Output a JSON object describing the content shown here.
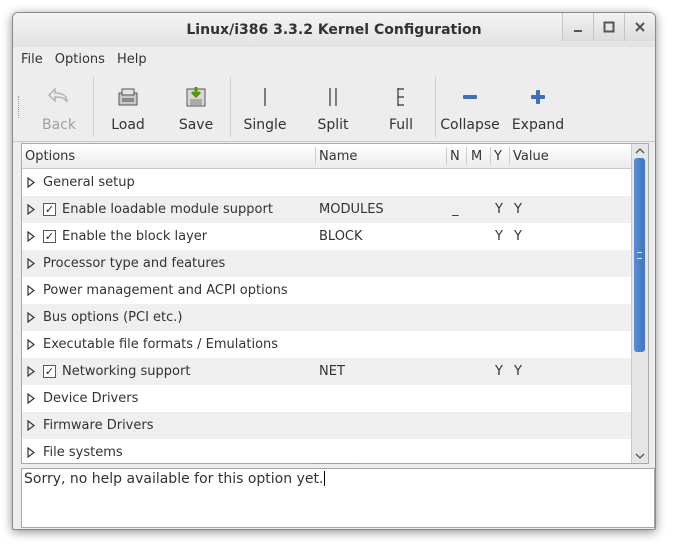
{
  "window": {
    "title": "Linux/i386 3.3.2 Kernel Configuration"
  },
  "menubar": {
    "items": [
      "File",
      "Options",
      "Help"
    ]
  },
  "toolbar": {
    "buttons": [
      {
        "label": "Back",
        "icon": "back-arrow-icon",
        "enabled": false
      },
      {
        "label": "Load",
        "icon": "load-icon",
        "enabled": true
      },
      {
        "label": "Save",
        "icon": "save-icon",
        "enabled": true
      },
      {
        "label": "Single",
        "icon": "single-view-icon",
        "enabled": true
      },
      {
        "label": "Split",
        "icon": "split-view-icon",
        "enabled": true
      },
      {
        "label": "Full",
        "icon": "full-view-icon",
        "enabled": true
      },
      {
        "label": "Collapse",
        "icon": "minus-icon",
        "enabled": true
      },
      {
        "label": "Expand",
        "icon": "plus-icon",
        "enabled": true
      }
    ]
  },
  "tree": {
    "columns": [
      "Options",
      "Name",
      "N",
      "M",
      "Y",
      "Value"
    ],
    "rows": [
      {
        "option": "General setup",
        "checked": null,
        "name": "",
        "n": "",
        "m": "",
        "y": "",
        "value": ""
      },
      {
        "option": "Enable loadable module support",
        "checked": true,
        "name": "MODULES",
        "n": "_",
        "m": "",
        "y": "Y",
        "value": "Y"
      },
      {
        "option": "Enable the block layer",
        "checked": true,
        "name": "BLOCK",
        "n": "",
        "m": "",
        "y": "Y",
        "value": "Y"
      },
      {
        "option": "Processor type and features",
        "checked": null,
        "name": "",
        "n": "",
        "m": "",
        "y": "",
        "value": ""
      },
      {
        "option": "Power management and ACPI options",
        "checked": null,
        "name": "",
        "n": "",
        "m": "",
        "y": "",
        "value": ""
      },
      {
        "option": "Bus options (PCI etc.)",
        "checked": null,
        "name": "",
        "n": "",
        "m": "",
        "y": "",
        "value": ""
      },
      {
        "option": "Executable file formats / Emulations",
        "checked": null,
        "name": "",
        "n": "",
        "m": "",
        "y": "",
        "value": ""
      },
      {
        "option": "Networking support",
        "checked": true,
        "name": "NET",
        "n": "",
        "m": "",
        "y": "Y",
        "value": "Y"
      },
      {
        "option": "Device Drivers",
        "checked": null,
        "name": "",
        "n": "",
        "m": "",
        "y": "",
        "value": ""
      },
      {
        "option": "Firmware Drivers",
        "checked": null,
        "name": "",
        "n": "",
        "m": "",
        "y": "",
        "value": ""
      },
      {
        "option": "File systems",
        "checked": null,
        "name": "",
        "n": "",
        "m": "",
        "y": "",
        "value": ""
      }
    ]
  },
  "help": {
    "text": "Sorry, no help available for this option yet."
  },
  "colors": {
    "scroll_thumb": "#3f74c3",
    "row_alt": "#efefef"
  }
}
